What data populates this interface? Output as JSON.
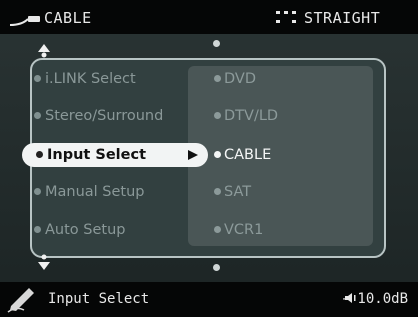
{
  "header": {
    "current_input": "CABLE",
    "listening_mode": "STRAIGHT",
    "input_icon": "cable-plug-icon",
    "mode_icon": "speaker-layout-icon"
  },
  "menu": {
    "items": [
      {
        "label": "i.LINK Select"
      },
      {
        "label": "Stereo/Surround"
      },
      {
        "label": "Input Select"
      },
      {
        "label": "Manual Setup"
      },
      {
        "label": "Auto Setup"
      }
    ],
    "active_item": "Input Select"
  },
  "options": {
    "items": [
      {
        "label": "DVD"
      },
      {
        "label": "DTV/LD"
      },
      {
        "label": "CABLE"
      },
      {
        "label": "SAT"
      },
      {
        "label": "VCR1"
      }
    ],
    "selected": "CABLE"
  },
  "footer": {
    "menu_name": "Input Select",
    "volume": "- 10.0dB",
    "menu_icon": "pencil-icon",
    "volume_icon": "speaker-icon"
  },
  "colors": {
    "background": "#2a3434",
    "panel": "#324040",
    "highlight": "#f2f4f4",
    "text": "#e8e8e8"
  }
}
